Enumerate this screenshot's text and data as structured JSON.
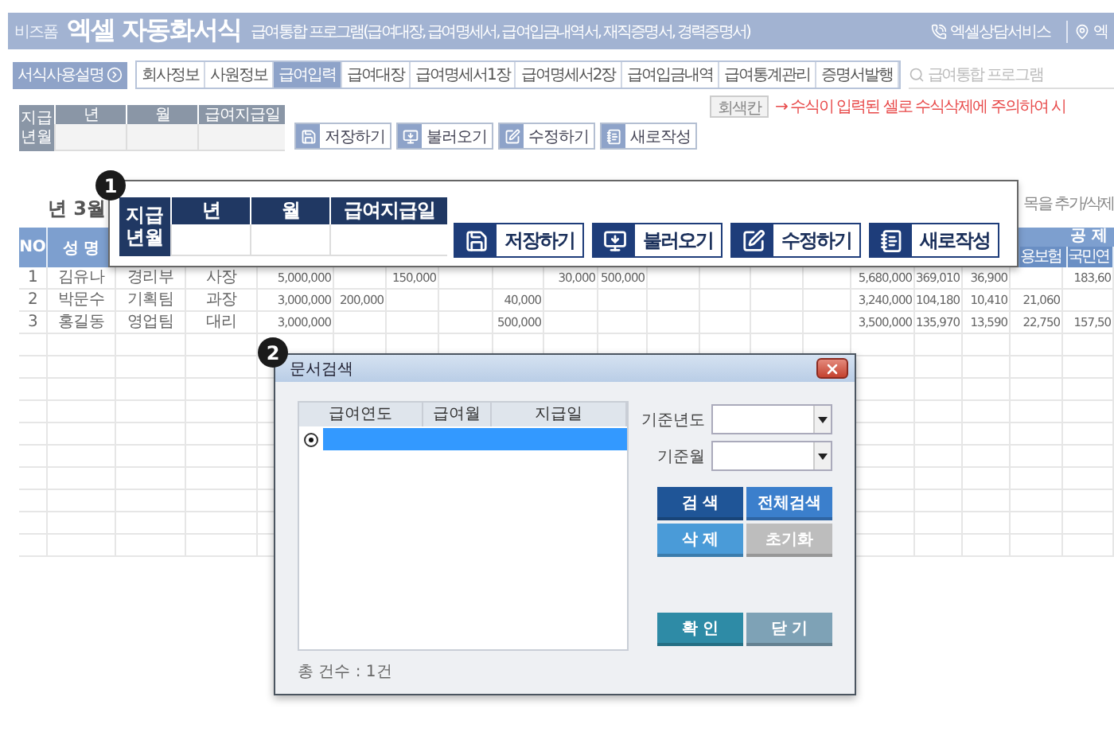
{
  "header": {
    "brand": "비즈폼",
    "title": "엑셀 자동화서식",
    "subtitle": "급여통합 프로그램(급여대장, 급여명세서, 급여입금내역서, 재직증명서, 경력증명서)",
    "links": [
      {
        "kind": "phone",
        "label": "엑셀상담서비스"
      },
      {
        "kind": "pin",
        "label": "엑"
      }
    ]
  },
  "nav": {
    "help": "서식사용설명",
    "tabs": [
      {
        "label": "회사정보",
        "selected": false
      },
      {
        "label": "사원정보",
        "selected": false
      },
      {
        "label": "급여입력",
        "selected": true
      },
      {
        "label": "급여대장",
        "selected": false
      },
      {
        "label": "급여명세서1장",
        "selected": false
      },
      {
        "label": "급여명세서2장",
        "selected": false
      },
      {
        "label": "급여입금내역",
        "selected": false
      },
      {
        "label": "급여통계관리",
        "selected": false
      },
      {
        "label": "증명서발행",
        "selected": false
      }
    ],
    "search": {
      "placeholder": "급여통합 프로그램"
    }
  },
  "toolbar": {
    "period": {
      "label": "지급 년월",
      "columns": [
        "년",
        "월",
        "급여지급일"
      ]
    },
    "buttons": [
      {
        "kind": "save",
        "label": "저장하기"
      },
      {
        "kind": "load",
        "label": "불러오기"
      },
      {
        "kind": "edit",
        "label": "수정하기"
      },
      {
        "kind": "new",
        "label": "새로작성"
      }
    ],
    "gray_button": "회색칸",
    "warning": "→ 수식이 입력된 셀로 수식삭제에 주의하여 시"
  },
  "sheet": {
    "title": "년 3월",
    "note": "목을 추가/삭제",
    "header": {
      "left": [
        "NO",
        "성 명"
      ],
      "group": "공 제",
      "sub": [
        "용보험",
        "국민연"
      ]
    },
    "rows": [
      [
        "1",
        "김유나",
        "경리부",
        "사장",
        "5,000,000",
        null,
        "150,000",
        null,
        null,
        "30,000",
        "500,000",
        null,
        null,
        null,
        null,
        "5,680,000",
        "369,010",
        "36,900",
        null,
        "183,60"
      ],
      [
        "2",
        "박문수",
        "기획팀",
        "과장",
        "3,000,000",
        "200,000",
        null,
        null,
        "40,000",
        null,
        null,
        null,
        null,
        null,
        null,
        "3,240,000",
        "104,180",
        "10,410",
        "21,060",
        null
      ],
      [
        "3",
        "홍길동",
        "영업팀",
        "대리",
        "3,000,000",
        null,
        null,
        null,
        "500,000",
        null,
        null,
        null,
        null,
        null,
        null,
        "3,500,000",
        "135,970",
        "13,590",
        "22,750",
        "157,50"
      ]
    ]
  },
  "callout": {
    "badge": "1",
    "period": {
      "label": "지급 년월",
      "columns": [
        "년",
        "월",
        "급여지급일"
      ]
    },
    "buttons": [
      {
        "kind": "save",
        "label": "저장하기"
      },
      {
        "kind": "load",
        "label": "불러오기"
      },
      {
        "kind": "edit",
        "label": "수정하기"
      },
      {
        "kind": "new",
        "label": "새로작성"
      }
    ]
  },
  "dialog": {
    "badge": "2",
    "title": "문서검색",
    "list": {
      "columns": [
        "급여연도",
        "급여월",
        "지급일"
      ],
      "rows": [
        {
          "selected": true
        }
      ]
    },
    "filters": [
      {
        "label": "기준년도"
      },
      {
        "label": "기준월"
      }
    ],
    "search_buttons": [
      {
        "label": "검 색",
        "color": "#1f5597"
      },
      {
        "label": "전체검색",
        "color": "#3b7fcc"
      },
      {
        "label": "삭 제",
        "color": "#4a9bd8"
      },
      {
        "label": "초기화",
        "color": "#bdbdbd"
      }
    ],
    "confirm_buttons": [
      {
        "label": "확 인",
        "color": "#2e8ba6"
      },
      {
        "label": "닫 기",
        "color": "#7ea2b6"
      }
    ],
    "count": "총 건수 : 1건"
  }
}
